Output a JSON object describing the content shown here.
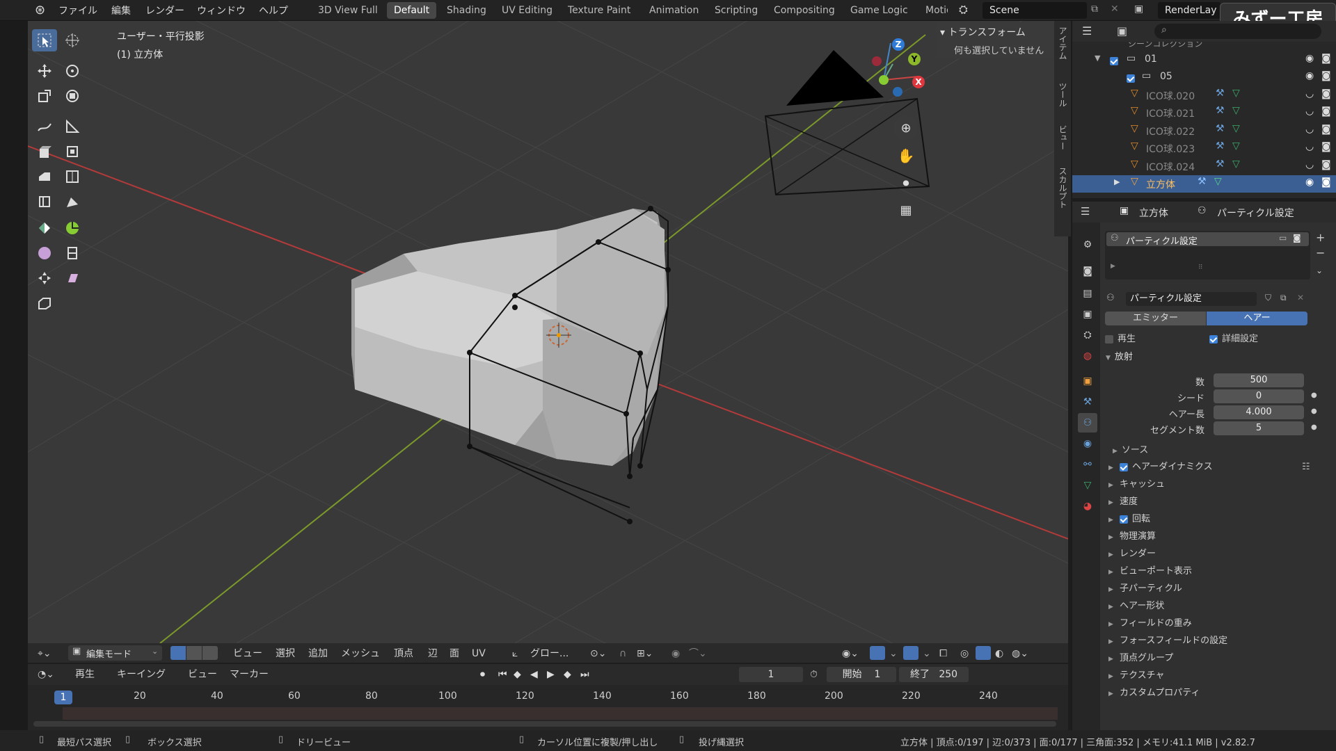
{
  "topbar": {
    "menus": [
      "ファイル",
      "編集",
      "レンダー",
      "ウィンドウ",
      "ヘルプ"
    ],
    "workspaces": [
      "3D View Full",
      "Default",
      "Shading",
      "UV Editing",
      "Texture Paint",
      "Animation",
      "Scripting",
      "Compositing",
      "Game Logic",
      "Motio"
    ],
    "active_workspace": "Default",
    "scene": "Scene",
    "view_layer": "RenderLay"
  },
  "watermark": "みずー工房",
  "viewport": {
    "view_name": "ユーザー・平行投影",
    "object_label": "(1) 立方体",
    "transform_title": "トランスフォーム",
    "nothing_selected": "何も選択していません",
    "side_tabs": [
      "アイテム",
      "ツール",
      "ビュー",
      "スカルプト"
    ],
    "axis_labels": {
      "x": "X",
      "y": "Y",
      "z": "Z"
    }
  },
  "outliner": {
    "header_cut": "シーンコレクション",
    "rows": [
      {
        "name": "01",
        "type": "collection",
        "checked": true
      },
      {
        "name": "05",
        "type": "collection",
        "checked": true
      },
      {
        "name": "ICO球.020",
        "type": "mesh"
      },
      {
        "name": "ICO球.021",
        "type": "mesh"
      },
      {
        "name": "ICO球.022",
        "type": "mesh"
      },
      {
        "name": "ICO球.023",
        "type": "mesh"
      },
      {
        "name": "ICO球.024",
        "type": "mesh"
      },
      {
        "name": "立方体",
        "type": "mesh",
        "selected": true
      }
    ]
  },
  "properties": {
    "object_name": "立方体",
    "context_tab": "パーティクル設定",
    "slot_name": "パーティクル設定",
    "datablock_name": "パーティクル設定",
    "type_emitter": "エミッター",
    "type_hair": "ヘアー",
    "regrow_label": "再生",
    "advanced_label": "詳細設定",
    "emission_header": "放射",
    "fields": [
      {
        "label": "数",
        "value": "500"
      },
      {
        "label": "シード",
        "value": "0"
      },
      {
        "label": "ヘアー長",
        "value": "4.000"
      },
      {
        "label": "セグメント数",
        "value": "5"
      }
    ],
    "source_label": "ソース",
    "sections": [
      {
        "label": "ヘアーダイナミクス",
        "checkbox": true
      },
      {
        "label": "キャッシュ"
      },
      {
        "label": "速度"
      },
      {
        "label": "回転",
        "checkbox": true
      },
      {
        "label": "物理演算"
      },
      {
        "label": "レンダー"
      },
      {
        "label": "ビューポート表示"
      },
      {
        "label": "子パーティクル"
      },
      {
        "label": "ヘアー形状"
      },
      {
        "label": "フィールドの重み"
      },
      {
        "label": "フォースフィールドの設定"
      },
      {
        "label": "頂点グループ"
      },
      {
        "label": "テクスチャ"
      },
      {
        "label": "カスタムプロパティ"
      }
    ]
  },
  "viewheader": {
    "mode": "編集モード",
    "menus": [
      "ビュー",
      "選択",
      "追加",
      "メッシュ",
      "頂点",
      "辺",
      "面",
      "UV"
    ],
    "orientation": "グロー..."
  },
  "timeline": {
    "menus": [
      "再生",
      "キーイング",
      "ビュー",
      "マーカー"
    ],
    "current_frame": "1",
    "start_label": "開始",
    "start": "1",
    "end_label": "終了",
    "end": "250",
    "ticks": [
      "20",
      "40",
      "60",
      "80",
      "100",
      "120",
      "140",
      "160",
      "180",
      "200",
      "220",
      "240"
    ],
    "current_badge": "1"
  },
  "statusbar": {
    "left_hints": [
      "最短パス選択",
      "ボックス選択",
      "ドリービュー"
    ],
    "mid_hints": [
      "カーソル位置に複製/押し出し",
      "投げ縄選択"
    ],
    "stats": "立方体 | 頂点:0/197 | 辺:0/373 | 面:0/177 | 三角面:352 | メモリ:41.1 MiB | v2.82.7"
  }
}
